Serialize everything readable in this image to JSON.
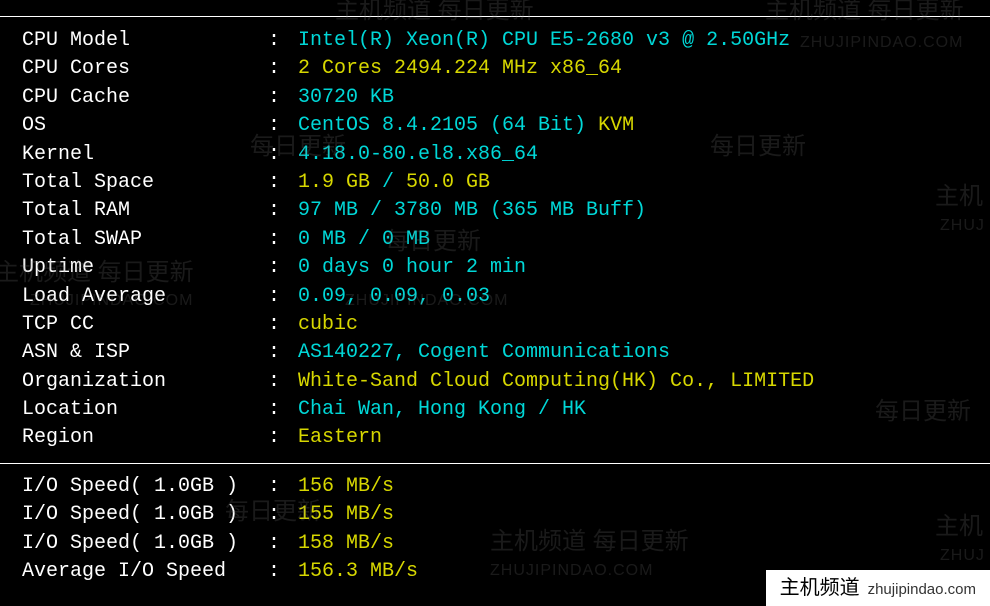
{
  "rows": [
    {
      "label": " CPU Model",
      "parts": [
        {
          "text": "Intel(R) Xeon(R) CPU E5-2680 v3 @ 2.50GHz",
          "class": "c-cyan"
        }
      ]
    },
    {
      "label": " CPU Cores",
      "parts": [
        {
          "text": "2 Cores 2494.224 MHz x86_64",
          "class": "c-yellow"
        }
      ]
    },
    {
      "label": " CPU Cache",
      "parts": [
        {
          "text": "30720 KB",
          "class": "c-cyan"
        }
      ]
    },
    {
      "label": " OS",
      "parts": [
        {
          "text": "CentOS 8.4.2105 (64 Bit)",
          "class": "c-cyan"
        },
        {
          "text": " ",
          "class": "c-white"
        },
        {
          "text": "KVM",
          "class": "c-yellow"
        }
      ]
    },
    {
      "label": " Kernel",
      "parts": [
        {
          "text": "4.18.0-80.el8.x86_64",
          "class": "c-cyan"
        }
      ]
    },
    {
      "label": " Total Space",
      "parts": [
        {
          "text": "1.9 GB",
          "class": "c-yellow"
        },
        {
          "text": " / ",
          "class": "c-cyan"
        },
        {
          "text": "50.0 GB",
          "class": "c-yellow"
        }
      ]
    },
    {
      "label": " Total RAM",
      "parts": [
        {
          "text": "97 MB / 3780 MB (365 MB Buff)",
          "class": "c-cyan"
        }
      ]
    },
    {
      "label": " Total SWAP",
      "parts": [
        {
          "text": "0 MB / 0 MB",
          "class": "c-cyan"
        }
      ]
    },
    {
      "label": " Uptime",
      "parts": [
        {
          "text": "0 days 0 hour 2 min",
          "class": "c-cyan"
        }
      ]
    },
    {
      "label": " Load Average",
      "parts": [
        {
          "text": "0.09, 0.09, 0.03",
          "class": "c-cyan"
        }
      ]
    },
    {
      "label": " TCP CC",
      "parts": [
        {
          "text": "cubic",
          "class": "c-yellow"
        }
      ]
    },
    {
      "label": " ASN & ISP",
      "parts": [
        {
          "text": "AS140227, Cogent Communications",
          "class": "c-cyan"
        }
      ]
    },
    {
      "label": " Organization",
      "parts": [
        {
          "text": "White-Sand Cloud Computing(HK) Co., LIMITED",
          "class": "c-yellow"
        }
      ]
    },
    {
      "label": " Location",
      "parts": [
        {
          "text": "Chai Wan, Hong Kong / HK",
          "class": "c-cyan"
        }
      ]
    },
    {
      "label": " Region",
      "parts": [
        {
          "text": "Eastern",
          "class": "c-yellow"
        }
      ]
    }
  ],
  "io_rows": [
    {
      "label": " I/O Speed( 1.0GB )",
      "parts": [
        {
          "text": "156 MB/s",
          "class": "c-yellow"
        }
      ]
    },
    {
      "label": " I/O Speed( 1.0GB )",
      "parts": [
        {
          "text": "155 MB/s",
          "class": "c-yellow"
        }
      ]
    },
    {
      "label": " I/O Speed( 1.0GB )",
      "parts": [
        {
          "text": "158 MB/s",
          "class": "c-yellow"
        }
      ]
    },
    {
      "label": " Average I/O Speed",
      "parts": [
        {
          "text": "156.3 MB/s",
          "class": "c-yellow"
        }
      ]
    }
  ],
  "separator": ":",
  "watermarks": {
    "cn": "主机频道 每日更新",
    "en": "ZHUJIPINDAO.COM",
    "cn_short": "每日更新",
    "zj": "主机",
    "zjpd": "ZHUJ"
  },
  "badge": {
    "main": "主机频道",
    "url": "zhujipindao.com"
  }
}
